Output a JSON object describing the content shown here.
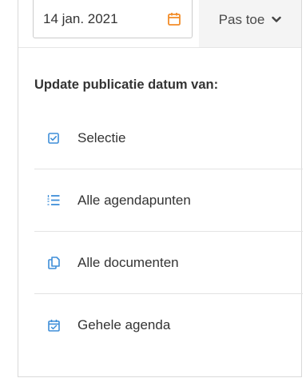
{
  "colors": {
    "accent_orange": "#f28c28",
    "icon_blue": "#3e8ed8",
    "text": "#333333",
    "border": "#d9d9d9"
  },
  "date_field": {
    "value": "14 jan. 2021",
    "icon": "calendar-icon"
  },
  "apply_button": {
    "label": "Pas toe",
    "icon": "chevron-down-icon"
  },
  "section": {
    "title": "Update publicatie datum van:"
  },
  "options": [
    {
      "label": "Selectie",
      "icon": "checkbox-icon"
    },
    {
      "label": "Alle agendapunten",
      "icon": "numbered-list-icon"
    },
    {
      "label": "Alle documenten",
      "icon": "documents-icon"
    },
    {
      "label": "Gehele agenda",
      "icon": "calendar-check-icon"
    }
  ]
}
